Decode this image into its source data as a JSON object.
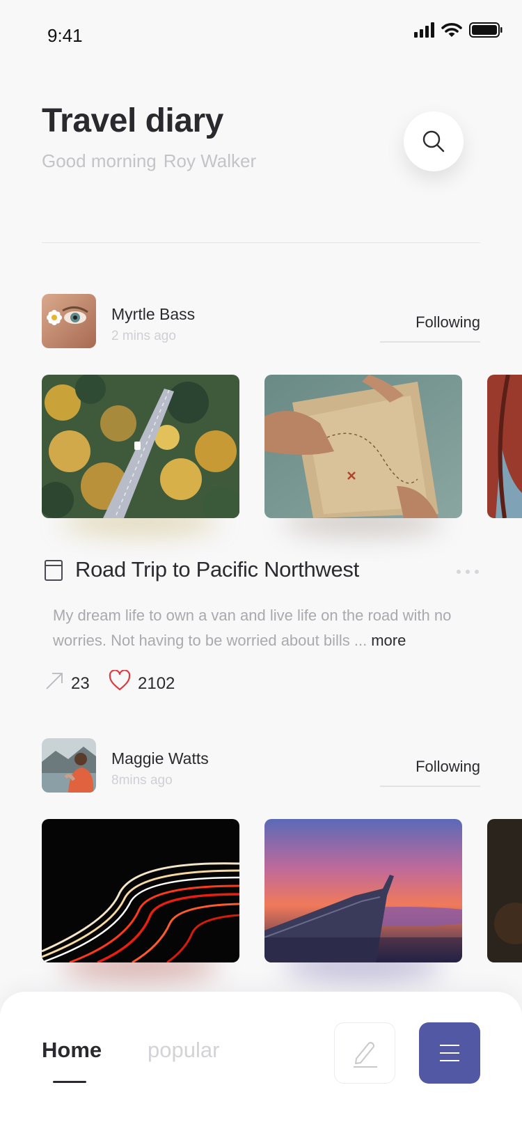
{
  "status_bar": {
    "time": "9:41"
  },
  "header": {
    "title": "Travel diary",
    "greeting": "Good morning",
    "user_name": "Roy Walker"
  },
  "posts": [
    {
      "author": "Myrtle Bass",
      "time_ago": "2 mins ago",
      "follow_label": "Following",
      "title": "Road Trip to Pacific Northwest",
      "excerpt": "My dream life to own a van and live life on the road with no worries. Not having to be worried about bills ...",
      "more_label": "more",
      "shares": "23",
      "likes": "2102",
      "photos": [
        "forest-road-photo",
        "treasure-map-photo",
        "canoe-photo"
      ]
    },
    {
      "author": "Maggie Watts",
      "time_ago": "8mins ago",
      "follow_label": "Following",
      "photos": [
        "light-trails-photo",
        "airplane-wing-sunset-photo",
        "dark-photo"
      ]
    }
  ],
  "bottom_nav": {
    "home": "Home",
    "popular": "popular"
  },
  "colors": {
    "accent": "#5258a4",
    "like": "#e0383e",
    "muted_text": "#c4c4c8"
  }
}
